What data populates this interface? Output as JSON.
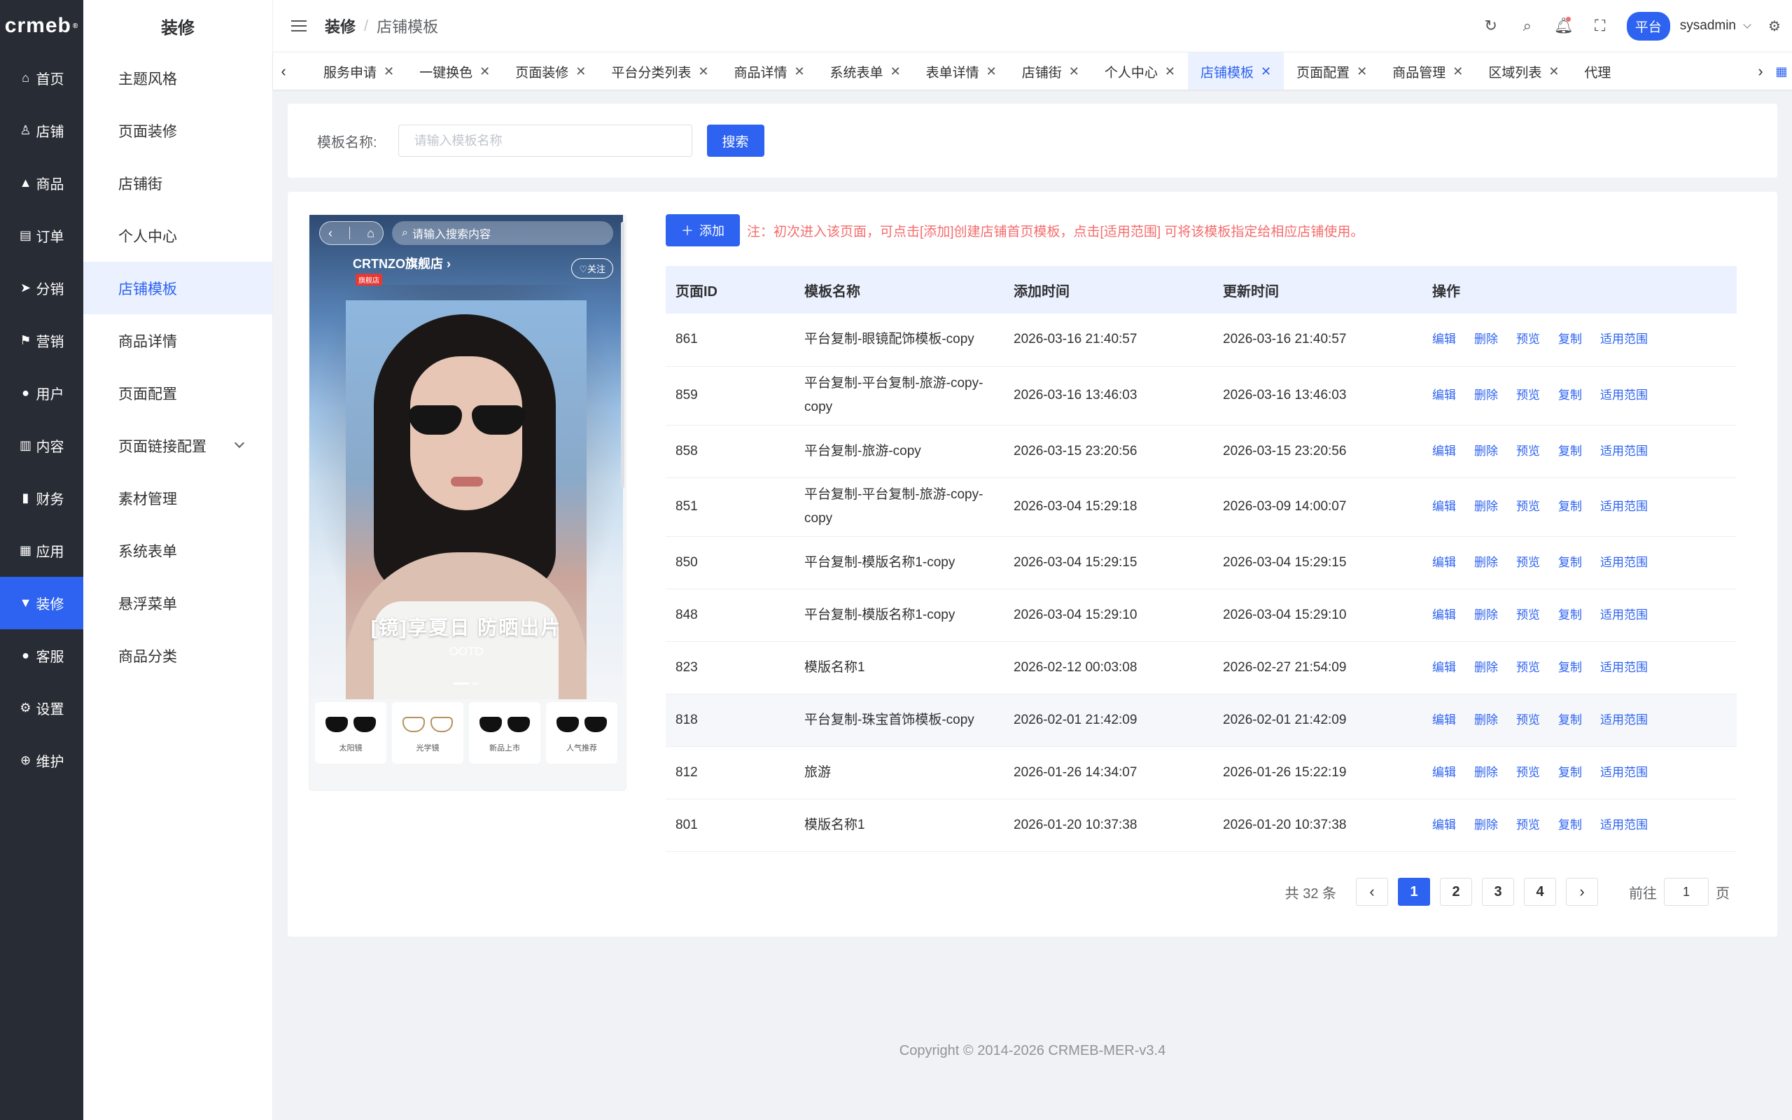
{
  "logo": "crmeb",
  "rail": [
    {
      "icon": "home-icon",
      "glyph": "⌂",
      "label": "首页"
    },
    {
      "icon": "store-icon",
      "glyph": "♙",
      "label": "店铺"
    },
    {
      "icon": "bag-icon",
      "glyph": "▲",
      "label": "商品"
    },
    {
      "icon": "order-icon",
      "glyph": "▤",
      "label": "订单"
    },
    {
      "icon": "share-icon",
      "glyph": "➤",
      "label": "分销"
    },
    {
      "icon": "flag-icon",
      "glyph": "⚑",
      "label": "营销"
    },
    {
      "icon": "user-icon",
      "glyph": "●",
      "label": "用户"
    },
    {
      "icon": "content-icon",
      "glyph": "▥",
      "label": "内容"
    },
    {
      "icon": "finance-icon",
      "glyph": "▮",
      "label": "财务"
    },
    {
      "icon": "apps-icon",
      "glyph": "▦",
      "label": "应用"
    },
    {
      "icon": "decorate-icon",
      "glyph": "▼",
      "label": "装修",
      "active": true
    },
    {
      "icon": "service-icon",
      "glyph": "●",
      "label": "客服"
    },
    {
      "icon": "settings-icon",
      "glyph": "⚙",
      "label": "设置"
    },
    {
      "icon": "maintain-icon",
      "glyph": "⊕",
      "label": "维护"
    }
  ],
  "submenu": {
    "title": "装修",
    "items": [
      "主题风格",
      "页面装修",
      "店铺街",
      "个人中心",
      "店铺模板",
      "商品详情",
      "页面配置",
      "页面链接配置",
      "素材管理",
      "系统表单",
      "悬浮菜单",
      "商品分类"
    ],
    "active_index": 4
  },
  "header": {
    "breadcrumb_root": "装修",
    "breadcrumb_sep": "/",
    "breadcrumb_current": "店铺模板",
    "platform_label": "平台",
    "username": "sysadmin"
  },
  "tabs": [
    "服务申请",
    "一键换色",
    "页面装修",
    "平台分类列表",
    "商品详情",
    "系统表单",
    "表单详情",
    "店铺街",
    "个人中心",
    "店铺模板",
    "页面配置",
    "商品管理",
    "区域列表",
    "代理"
  ],
  "tabs_active_index": 9,
  "search": {
    "label": "模板名称:",
    "placeholder": "请输入模板名称",
    "button": "搜索"
  },
  "phone": {
    "search_placeholder": "请输入搜索内容",
    "store_name": "CRTNZO旗舰店 ›",
    "store_badge": "旗舰店",
    "follow": "♡关注",
    "banner_title": "[镜]享夏日 防晒出片",
    "banner_sub": "OOTD",
    "categories": [
      "太阳镜",
      "光学镜",
      "新品上市",
      "人气推荐"
    ]
  },
  "toolbar": {
    "add_label": "添加",
    "note": "注：初次进入该页面，可点击[添加]创建店铺首页模板，点击[适用范围] 可将该模板指定给相应店铺使用。"
  },
  "table": {
    "columns": [
      "页面ID",
      "模板名称",
      "添加时间",
      "更新时间",
      "操作"
    ],
    "actions": [
      "编辑",
      "删除",
      "预览",
      "复制",
      "适用范围"
    ],
    "rows": [
      {
        "id": "861",
        "name": "平台复制-眼镜配饰模板-copy",
        "added": "2026-03-16 21:40:57",
        "updated": "2026-03-16 21:40:57"
      },
      {
        "id": "859",
        "name": "平台复制-平台复制-旅游-copy-copy",
        "added": "2026-03-16 13:46:03",
        "updated": "2026-03-16 13:46:03"
      },
      {
        "id": "858",
        "name": "平台复制-旅游-copy",
        "added": "2026-03-15 23:20:56",
        "updated": "2026-03-15 23:20:56"
      },
      {
        "id": "851",
        "name": "平台复制-平台复制-旅游-copy-copy",
        "added": "2026-03-04 15:29:18",
        "updated": "2026-03-09 14:00:07"
      },
      {
        "id": "850",
        "name": "平台复制-模版名称1-copy",
        "added": "2026-03-04 15:29:15",
        "updated": "2026-03-04 15:29:15"
      },
      {
        "id": "848",
        "name": "平台复制-模版名称1-copy",
        "added": "2026-03-04 15:29:10",
        "updated": "2026-03-04 15:29:10"
      },
      {
        "id": "823",
        "name": "模版名称1",
        "added": "2026-02-12 00:03:08",
        "updated": "2026-02-27 21:54:09"
      },
      {
        "id": "818",
        "name": "平台复制-珠宝首饰模板-copy",
        "added": "2026-02-01 21:42:09",
        "updated": "2026-02-01 21:42:09"
      },
      {
        "id": "812",
        "name": "旅游",
        "added": "2026-01-26 14:34:07",
        "updated": "2026-01-26 15:22:19"
      },
      {
        "id": "801",
        "name": "模版名称1",
        "added": "2026-01-20 10:37:38",
        "updated": "2026-01-20 10:37:38"
      }
    ]
  },
  "pagination": {
    "total": "共 32 条",
    "pages": [
      "1",
      "2",
      "3",
      "4"
    ],
    "current": "1",
    "goto_prefix": "前往",
    "goto_value": "1",
    "goto_suffix": "页"
  },
  "copyright": "Copyright © 2014-2026 CRMEB-MER-v3.4",
  "colors": {
    "primary": "#2d63f0",
    "rail_bg": "#282c34",
    "note": "#f56c6c"
  }
}
